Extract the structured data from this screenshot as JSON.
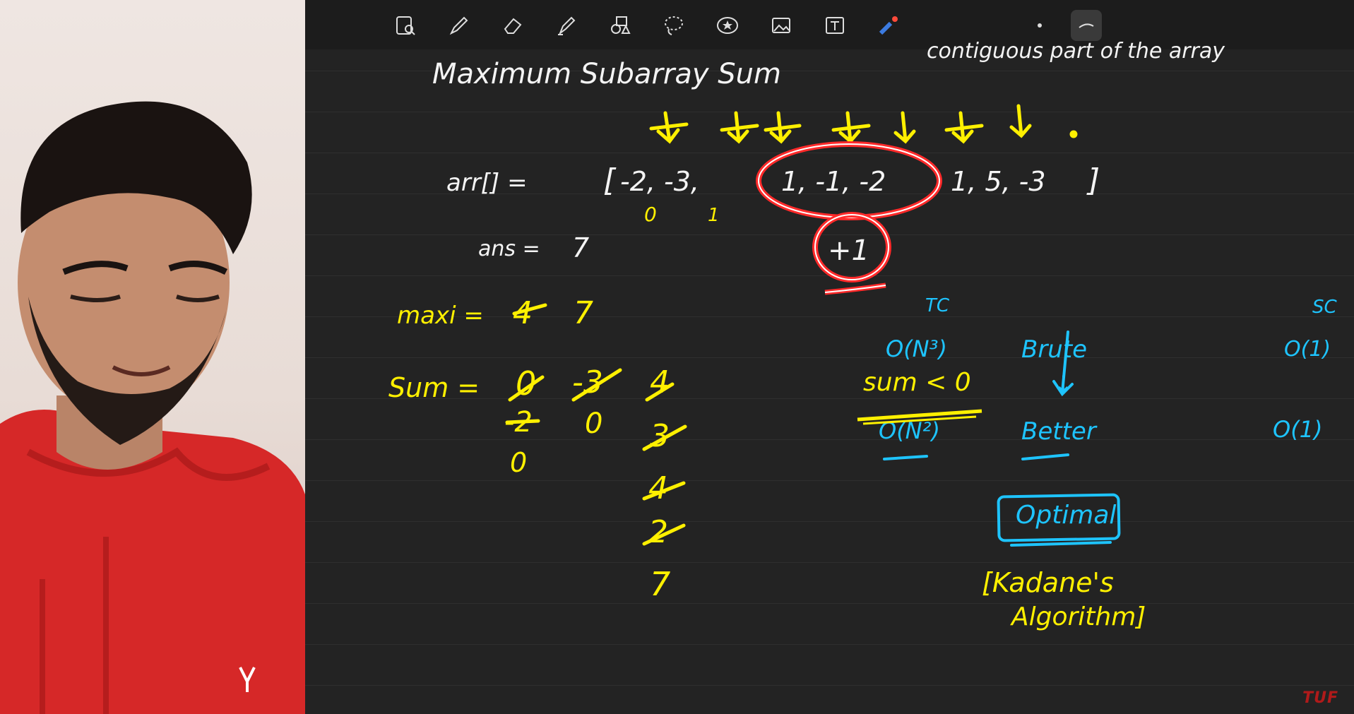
{
  "toolbar": {
    "tools": [
      {
        "name": "lasso-zoom-tool",
        "icon": "zoom-page-icon"
      },
      {
        "name": "pen-tool",
        "icon": "pen-icon"
      },
      {
        "name": "eraser-tool",
        "icon": "eraser-icon"
      },
      {
        "name": "highlighter-tool",
        "icon": "highlighter-icon"
      },
      {
        "name": "shapes-tool",
        "icon": "shapes-icon"
      },
      {
        "name": "lasso-tool",
        "icon": "lasso-icon"
      },
      {
        "name": "sticker-tool",
        "icon": "star-icon"
      },
      {
        "name": "image-tool",
        "icon": "image-icon"
      },
      {
        "name": "text-tool",
        "icon": "text-box-icon"
      },
      {
        "name": "laser-pointer-tool",
        "icon": "laser-pointer-icon"
      },
      {
        "name": "dot-pen-preset",
        "icon": "dot-icon"
      },
      {
        "name": "stroke-pen-preset",
        "icon": "stroke-icon"
      }
    ]
  },
  "notes": {
    "title": "Maximum Subarray Sum",
    "top_right_note": "contiguous part of the array",
    "array_label": "arr[] =",
    "array_open": "[",
    "array_prefix": "-2, -3,",
    "array_circled": "1, -1, -2",
    "array_suffix": "1, 5, -3",
    "array_close": "]",
    "index_0": "0",
    "index_1": "1",
    "circled_value": "+1",
    "ans_label": "ans =",
    "ans_value": "7",
    "maxi_label": "maxi =",
    "maxi_struck": "4",
    "maxi_value": "7",
    "sum_label": "Sum =",
    "sum_col1_a": "0",
    "sum_col1_b": "-2",
    "sum_col1_c": "0",
    "sum_col2_a": "-3",
    "sum_col2_b": "0",
    "sum_col3_a": "4",
    "sum_col3_b": "3",
    "sum_col3_c": "4",
    "sum_col3_d": "2",
    "sum_col3_e": "7",
    "condition": "sum < 0",
    "tc_header": "TC",
    "sc_header": "SC",
    "brute_tc": "O(N³)",
    "brute_label": "Brute",
    "brute_sc": "O(1)",
    "down_arrow": "↓",
    "better_tc": "O(N²)",
    "better_label": "Better",
    "better_sc": "O(1)",
    "optimal_label": "Optimal",
    "kadane_line1": "[Kadane's",
    "kadane_line2": "Algorithm]"
  },
  "watermark": "TUF",
  "colors": {
    "ink_white": "#f4f4f4",
    "ink_yellow": "#fff000",
    "ink_blue": "#1ec4ff",
    "ink_red": "#ff2a2a",
    "board": "#232323",
    "hoodie": "#d62828"
  }
}
